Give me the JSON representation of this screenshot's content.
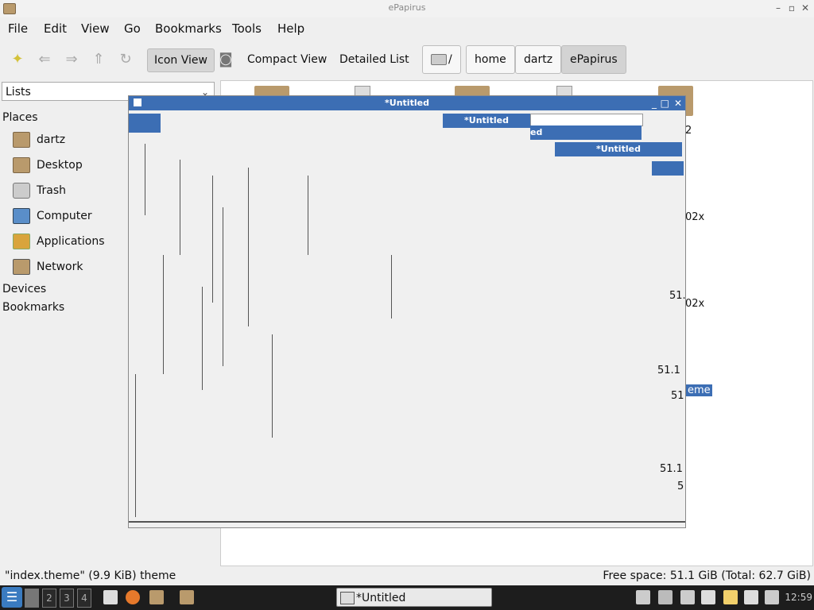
{
  "window": {
    "title": "ePapirus"
  },
  "menu": [
    "File",
    "Edit",
    "View",
    "Go",
    "Bookmarks",
    "Tools",
    "Help"
  ],
  "toolbar": {
    "icon_view": "Icon View",
    "compact_view": "Compact View",
    "detailed_list": "Detailed List"
  },
  "path": [
    "/",
    "home",
    "dartz",
    "ePapirus"
  ],
  "sidebar": {
    "selector": "Lists",
    "places_header": "Places",
    "places": [
      "dartz",
      "Desktop",
      "Trash",
      "Computer",
      "Applications",
      "Network"
    ],
    "devices_header": "Devices",
    "bookmarks_header": "Bookmarks"
  },
  "overlay": {
    "title": "*Untitled",
    "fragment_ed": "ed",
    "fragments": [
      "2",
      "02x",
      "51.",
      "02x",
      "51.1",
      "51",
      "51.1",
      "5"
    ],
    "selected_fragment": "eme"
  },
  "status": {
    "left": "\"index.theme\" (9.9 KiB) theme",
    "right": "Free space: 51.1 GiB (Total: 62.7 GiB)"
  },
  "taskbar": {
    "workspaces": [
      "2",
      "3",
      "4"
    ],
    "task_label": "*Untitled",
    "clock": "12:59"
  }
}
